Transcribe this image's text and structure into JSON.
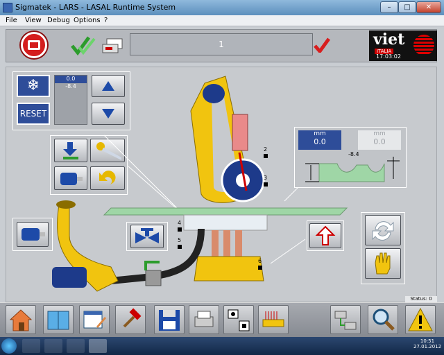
{
  "window": {
    "title": "Sigmatek - LARS - LASAL Runtime System",
    "min": "–",
    "max": "□",
    "close": "✕"
  },
  "menu": [
    {
      "label": "File"
    },
    {
      "label": "View"
    },
    {
      "label": "Debug"
    },
    {
      "label": "Options"
    },
    {
      "label": "?"
    }
  ],
  "toolbar": {
    "status_value": "1",
    "logo_text": "viet",
    "logo_sub": "ITALIA",
    "clock": "17:03:02"
  },
  "control_panel": {
    "value_top": "0.0",
    "value_bottom": "-8.4",
    "reset_label": "RESET"
  },
  "measure": {
    "unit_left": "mm",
    "value_left": "0.0",
    "unit_right": "mm",
    "value_right": "0.0",
    "profile_value": "-8.4"
  },
  "machine": {
    "markers": [
      "2",
      "3",
      "4",
      "5",
      "6"
    ]
  },
  "status": {
    "label": "Status: 0"
  },
  "system_tray": {
    "time": "10:51",
    "date": "27.01.2012"
  },
  "colors": {
    "accent": "#2e4d99",
    "stop": "#d41d1d",
    "machine_yellow": "#f1c40f",
    "check": "#d81e1e"
  }
}
